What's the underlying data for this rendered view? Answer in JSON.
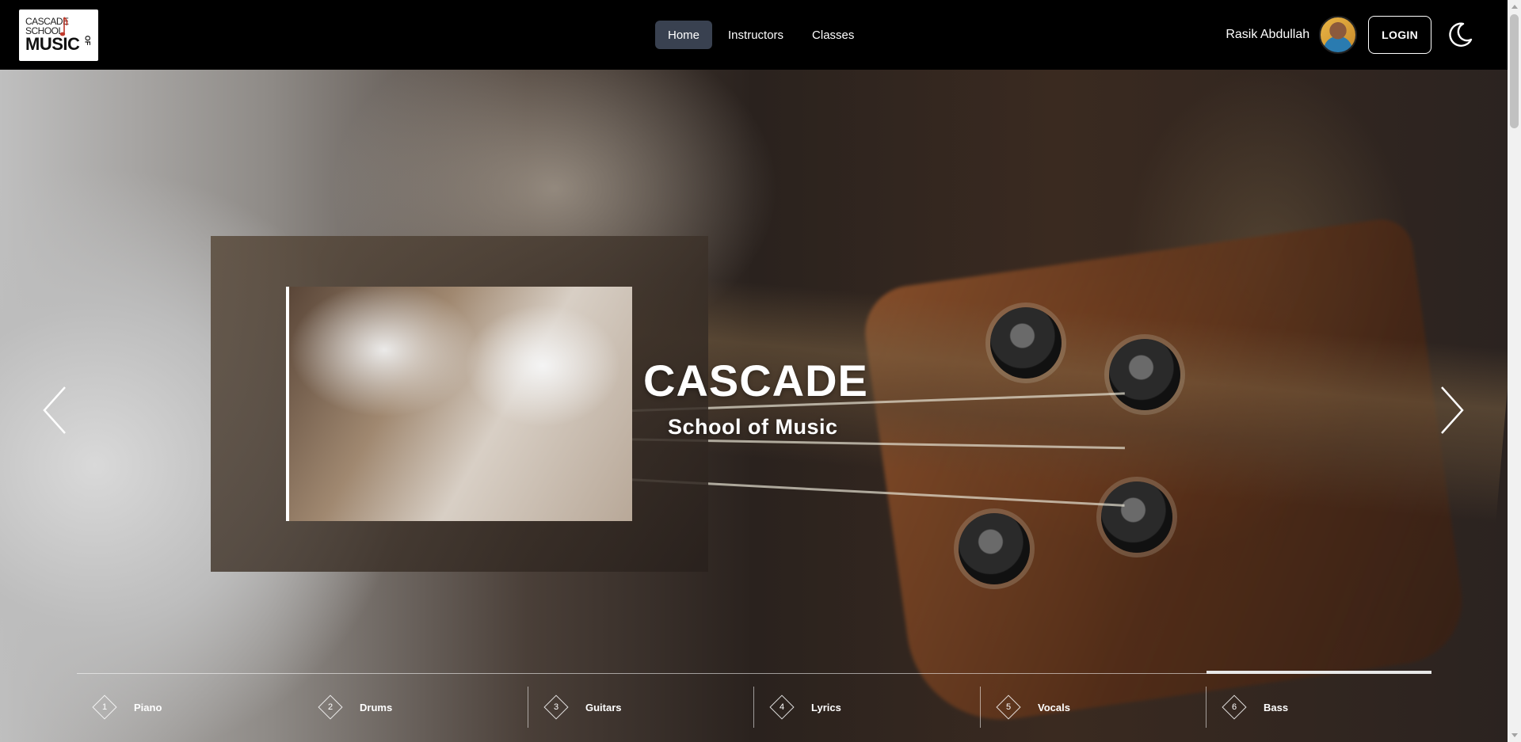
{
  "logo": {
    "line1": "CASCADE",
    "line2": "SCHOOL",
    "line3": "MUSIC",
    "of": "OF"
  },
  "nav": {
    "links": [
      {
        "label": "Home",
        "active": true
      },
      {
        "label": "Instructors",
        "active": false
      },
      {
        "label": "Classes",
        "active": false
      }
    ]
  },
  "user": {
    "name": "Rasik Abdullah"
  },
  "auth": {
    "login_label": "LOGIN"
  },
  "theme": {
    "icon": "moon-icon"
  },
  "hero": {
    "title": "CASCADE",
    "subtitle": "School of Music",
    "active_slide_index": 6
  },
  "tabs": [
    {
      "number": "1",
      "label": "Piano"
    },
    {
      "number": "2",
      "label": "Drums"
    },
    {
      "number": "3",
      "label": "Guitars"
    },
    {
      "number": "4",
      "label": "Lyrics"
    },
    {
      "number": "5",
      "label": "Vocals"
    },
    {
      "number": "6",
      "label": "Bass"
    }
  ],
  "colors": {
    "nav_bg": "#000000",
    "active_link_bg": "#394150",
    "logo_accent": "#c0392b"
  }
}
